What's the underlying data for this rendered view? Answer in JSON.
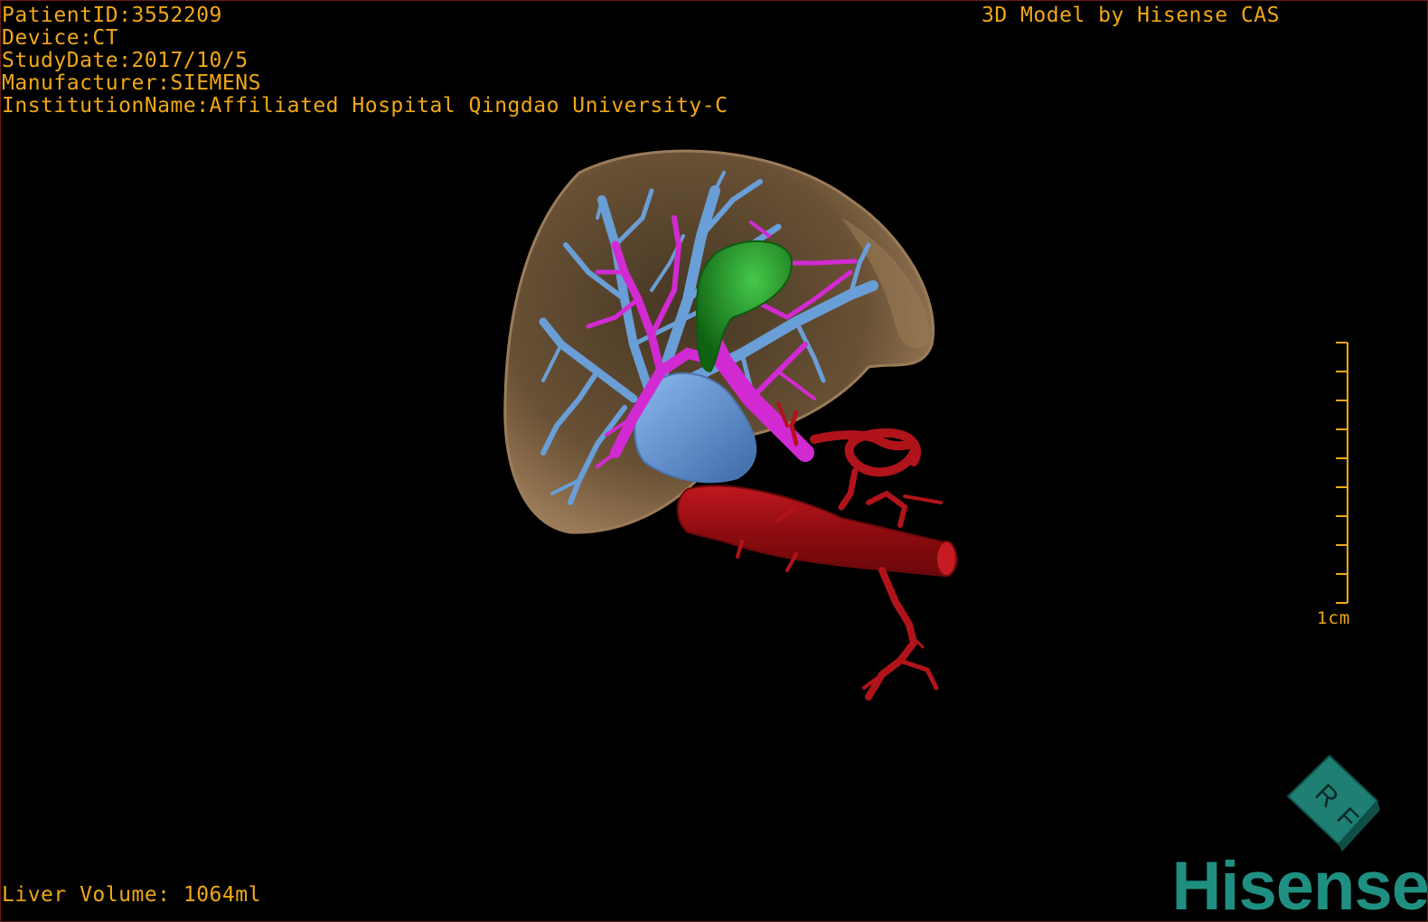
{
  "info": {
    "patient_id": "PatientID:3552209",
    "device": "Device:CT",
    "study_date": "StudyDate:2017/10/5",
    "manufacturer": "Manufacturer:SIEMENS",
    "institution": "InstitutionName:Affiliated Hospital Qingdao University-C"
  },
  "model_credit": "3D Model by Hisense CAS",
  "liver_volume": "Liver Volume: 1064ml",
  "scale": {
    "label": "1cm",
    "ticks": 10
  },
  "orientation_cube": {
    "face_top": "R",
    "face_side": "F"
  },
  "brand": "Hisense",
  "colors": {
    "overlay_text": "#f0a818",
    "liver": "#8a6a45",
    "hepatic_veins": "#6a9ed6",
    "portal_vein": "#d22ad2",
    "gallbladder": "#1f8a1f",
    "arteries": "#b0141a",
    "brand": "#1f8f82"
  }
}
